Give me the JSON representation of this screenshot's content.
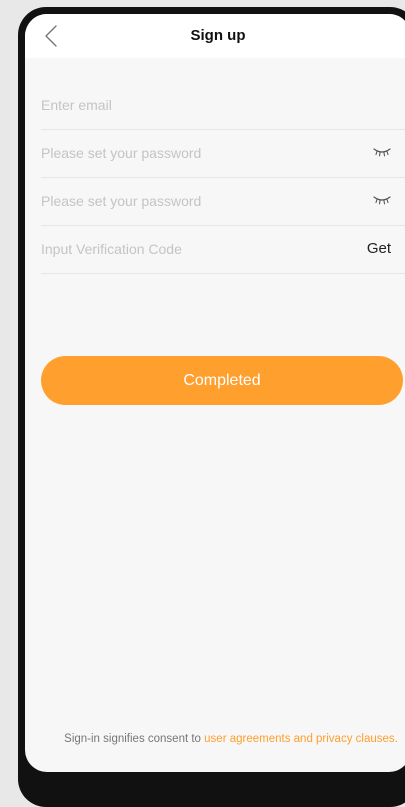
{
  "header": {
    "title": "Sign up",
    "back_icon": "chevron-left-icon"
  },
  "form": {
    "email_placeholder": "Enter email",
    "password_placeholder": "Please set your password",
    "confirm_password_placeholder": "Please set your password",
    "code_placeholder": "Input Verification Code",
    "get_code_label": "Get",
    "toggle_icon": "eye-closed-icon"
  },
  "submit": {
    "label": "Completed"
  },
  "footer": {
    "prefix": "Sign-in signifies consent to ",
    "link_text": "user agreements and privacy clauses."
  },
  "colors": {
    "accent": "#fe9f2e",
    "background": "#f7f7f7",
    "divider": "#e6e6e6"
  }
}
